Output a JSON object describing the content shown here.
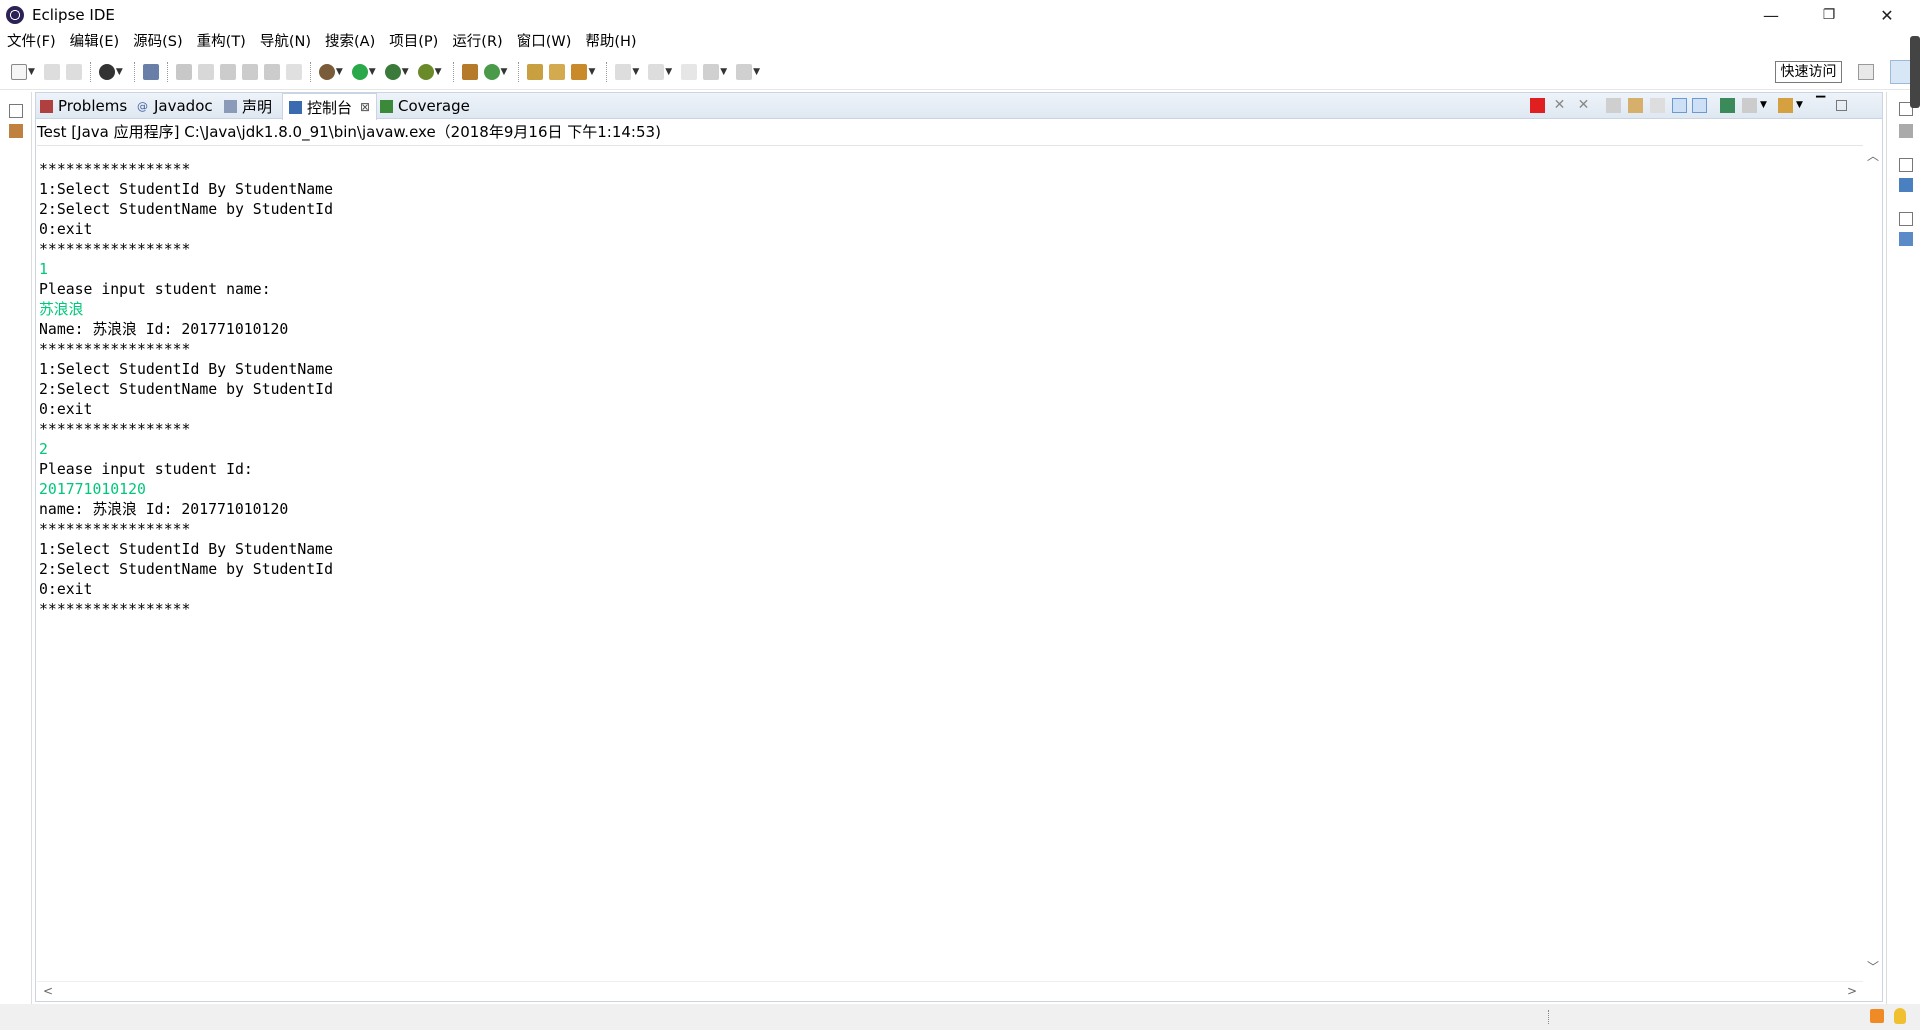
{
  "window": {
    "title": "Eclipse IDE",
    "minimize": "—",
    "maximize": "❐",
    "close": "✕"
  },
  "menu": [
    "文件(F)",
    "编辑(E)",
    "源码(S)",
    "重构(T)",
    "导航(N)",
    "搜索(A)",
    "项目(P)",
    "运行(R)",
    "窗口(W)",
    "帮助(H)"
  ],
  "toolbar": {
    "quick_access": "快速访问"
  },
  "tabs": [
    {
      "label": "Problems",
      "icon": "problems-icon"
    },
    {
      "label": "Javadoc",
      "icon": "javadoc-icon"
    },
    {
      "label": "声明",
      "icon": "declaration-icon"
    },
    {
      "label": "控制台",
      "icon": "console-icon",
      "active": true,
      "close": "⊠"
    },
    {
      "label": "Coverage",
      "icon": "coverage-icon"
    }
  ],
  "console": {
    "process": "Test [Java 应用程序] C:\\Java\\jdk1.8.0_91\\bin\\javaw.exe（2018年9月16日 下午1:14:53)",
    "lines": [
      {
        "text": "*****************",
        "input": false
      },
      {
        "text": "1:Select StudentId By StudentName",
        "input": false
      },
      {
        "text": "2:Select StudentName by StudentId",
        "input": false
      },
      {
        "text": "0:exit",
        "input": false
      },
      {
        "text": "*****************",
        "input": false
      },
      {
        "text": "1",
        "input": true
      },
      {
        "text": "Please input student name:",
        "input": false
      },
      {
        "text": "苏浪浪",
        "input": true
      },
      {
        "text": "Name: 苏浪浪 Id: 201771010120",
        "input": false
      },
      {
        "text": "*****************",
        "input": false
      },
      {
        "text": "1:Select StudentId By StudentName",
        "input": false
      },
      {
        "text": "2:Select StudentName by StudentId",
        "input": false
      },
      {
        "text": "0:exit",
        "input": false
      },
      {
        "text": "*****************",
        "input": false
      },
      {
        "text": "2",
        "input": true
      },
      {
        "text": "Please input student Id:",
        "input": false
      },
      {
        "text": "201771010120",
        "input": true
      },
      {
        "text": "name: 苏浪浪 Id: 201771010120",
        "input": false
      },
      {
        "text": "*****************",
        "input": false
      },
      {
        "text": "1:Select StudentId By StudentName",
        "input": false
      },
      {
        "text": "2:Select StudentName by StudentId",
        "input": false
      },
      {
        "text": "0:exit",
        "input": false
      },
      {
        "text": "*****************",
        "input": false
      }
    ]
  },
  "colors": {
    "input_text": "#00c87a",
    "terminate": "#e02020",
    "tab_bg": "#dfe8f2"
  }
}
